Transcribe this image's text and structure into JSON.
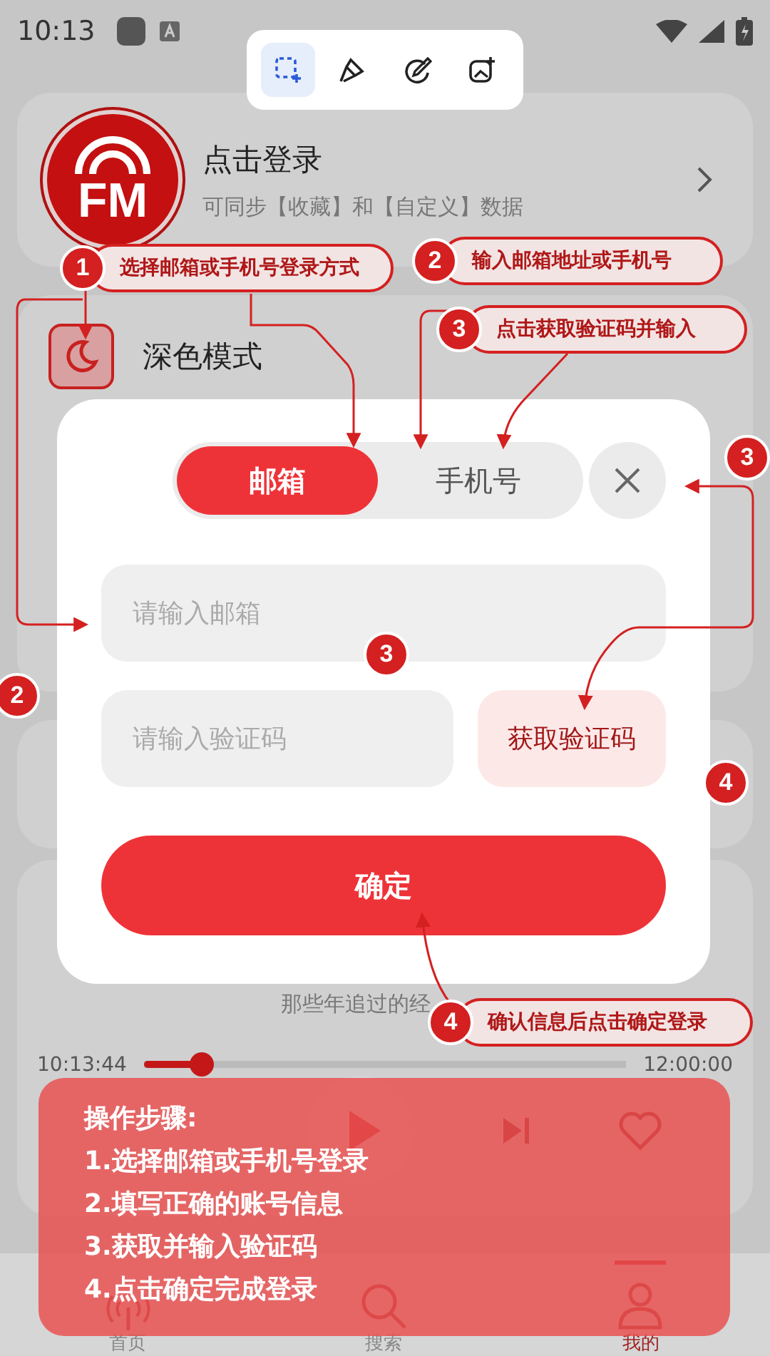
{
  "status_bar": {
    "time": "10:13"
  },
  "capture_toolbar": {
    "tools": [
      {
        "kind": "region",
        "selected": true
      },
      {
        "kind": "brush",
        "selected": false
      },
      {
        "kind": "edit",
        "selected": false
      },
      {
        "kind": "image",
        "selected": false
      }
    ]
  },
  "profile": {
    "logo": "FM",
    "title": "点击登录",
    "subtitle": "可同步【收藏】和【自定义】数据"
  },
  "dark_mode": {
    "label": "深色模式"
  },
  "player": {
    "song": "那些年追过的经",
    "elapsed": "10:13:44",
    "total": "12:00:00",
    "level": 0.12
  },
  "nav": [
    {
      "label": "首页",
      "kind": "radio",
      "selected": false
    },
    {
      "label": "搜索",
      "kind": "search",
      "selected": false
    },
    {
      "label": "我的",
      "kind": "user",
      "selected": true
    }
  ],
  "login_dialog": {
    "tabs": [
      {
        "label": "邮箱",
        "selected": true
      },
      {
        "label": "手机号",
        "selected": false
      }
    ],
    "email_placeholder": "请输入邮箱",
    "code_placeholder": "请输入验证码",
    "get_code": "获取验证码",
    "confirm": "确定"
  },
  "callouts": [
    {
      "number": "1",
      "text": "选择邮箱或手机号登录方式"
    },
    {
      "number": "2",
      "text": "输入邮箱地址或手机号"
    },
    {
      "number": "3",
      "text": "点击获取验证码并输入"
    },
    {
      "number": "4",
      "text": "确认信息后点击确定登录"
    }
  ],
  "markers": [
    "3",
    "2",
    "3",
    "4"
  ],
  "steps": {
    "title": "操作步骤:",
    "items": [
      "1.选择邮箱或手机号登录",
      "2.填写正确的账号信息",
      "3.获取并输入验证码",
      "4.点击确定完成登录"
    ]
  }
}
